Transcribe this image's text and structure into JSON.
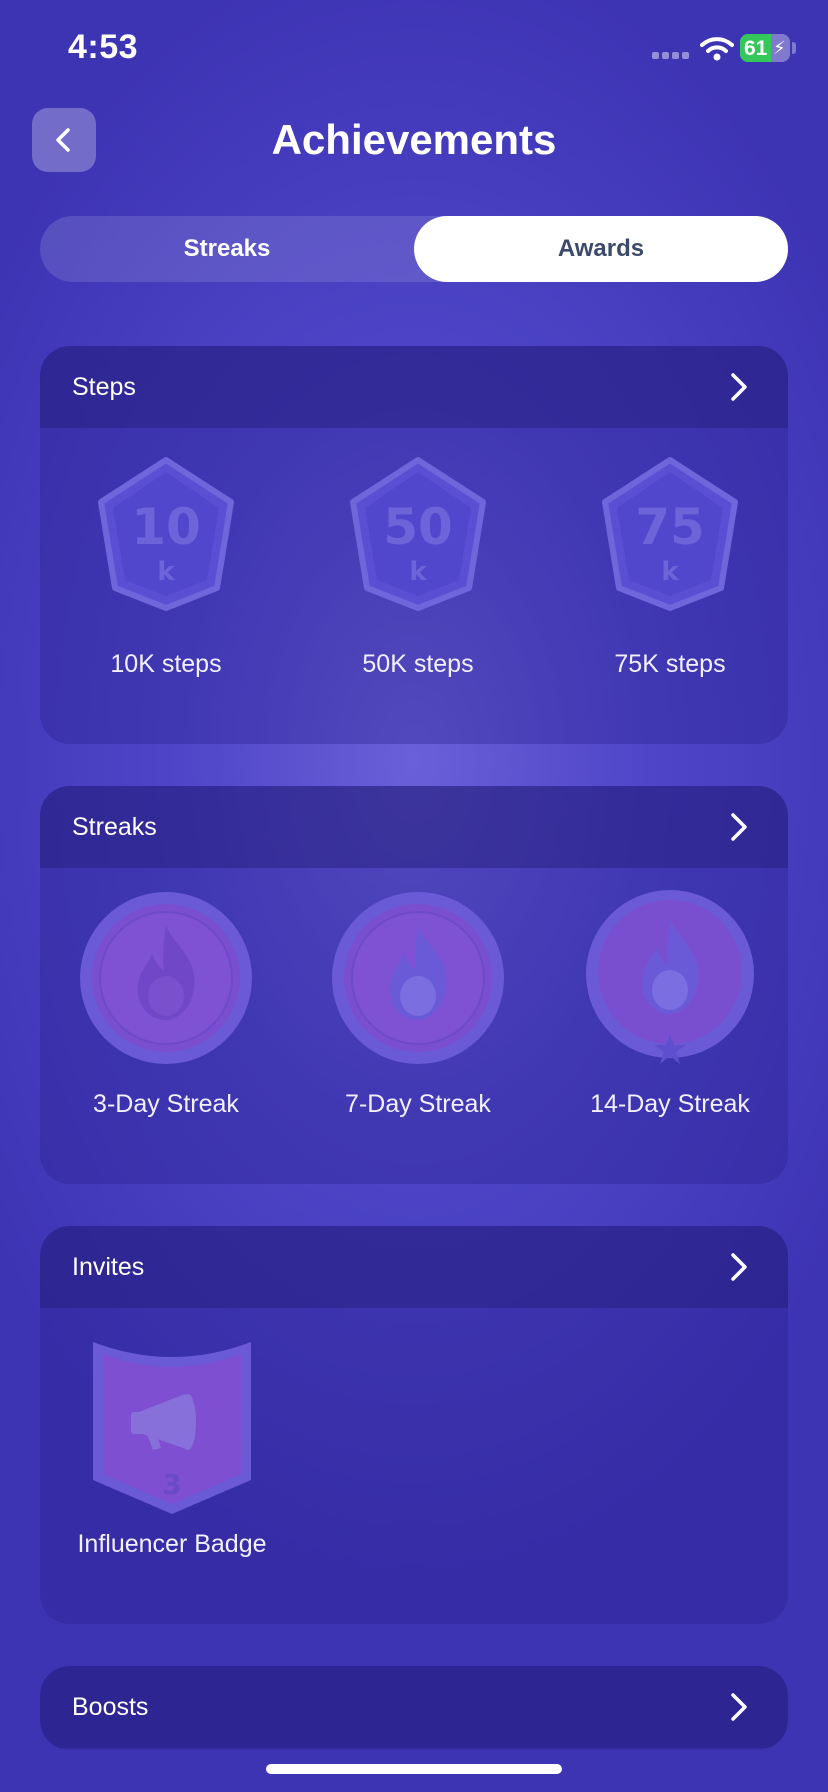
{
  "status": {
    "time": "4:53",
    "battery": "61",
    "battery_fraction": 0.61
  },
  "header": {
    "title": "Achievements",
    "back_icon": "chevron-left-icon"
  },
  "tabs": [
    {
      "label": "Streaks",
      "selected": false
    },
    {
      "label": "Awards",
      "selected": true
    }
  ],
  "sections": {
    "steps": {
      "title": "Steps",
      "items": [
        {
          "label": "10K steps",
          "badge_number": "10",
          "badge_unit": "k"
        },
        {
          "label": "50K steps",
          "badge_number": "50",
          "badge_unit": "k"
        },
        {
          "label": "75K steps",
          "badge_number": "75",
          "badge_unit": "k"
        }
      ]
    },
    "streaks": {
      "title": "Streaks",
      "items": [
        {
          "label": "3-Day Streak"
        },
        {
          "label": "7-Day Streak"
        },
        {
          "label": "14-Day Streak"
        }
      ]
    },
    "invites": {
      "title": "Invites",
      "items": [
        {
          "label": "Influencer Badge",
          "badge_number": "3"
        }
      ]
    },
    "boosts": {
      "title": "Boosts"
    }
  },
  "colors": {
    "background": "#4e45c8",
    "badge_purple": "#7b4fd0",
    "selected_tab_text": "#3c4a6a"
  }
}
